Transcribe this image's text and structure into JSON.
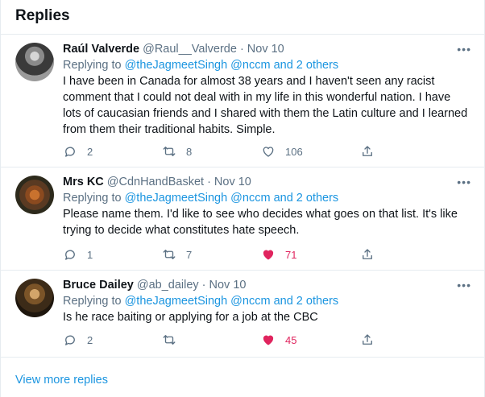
{
  "header": {
    "title": "Replies"
  },
  "replies": [
    {
      "name": "Raúl Valverde",
      "handle": "@Raul__Valverde",
      "separator": "·",
      "date": "Nov 10",
      "replying_prefix": "Replying to",
      "replying_to": "@theJagmeetSingh @nccm and 2 others",
      "text": "I have been in Canada for almost 38 years and I haven't seen any racist comment that I could not deal with in my life in this wonderful nation. I have lots of caucasian friends and I shared with them the Latin culture and I learned from them their traditional habits. Simple.",
      "replies": "2",
      "retweets": "8",
      "likes": "106",
      "liked": false
    },
    {
      "name": "Mrs KC",
      "handle": "@CdnHandBasket",
      "separator": "·",
      "date": "Nov 10",
      "replying_prefix": "Replying to",
      "replying_to": "@theJagmeetSingh @nccm and 2 others",
      "text": "Please name them. I'd like to see who decides what goes on that list. It's like trying to decide what constitutes hate speech.",
      "replies": "1",
      "retweets": "7",
      "likes": "71",
      "liked": true
    },
    {
      "name": "Bruce Dailey",
      "handle": "@ab_dailey",
      "separator": "·",
      "date": "Nov 10",
      "replying_prefix": "Replying to",
      "replying_to": "@theJagmeetSingh @nccm and 2 others",
      "text": "Is he race baiting or applying for a job at the CBC",
      "replies": "2",
      "retweets": "",
      "likes": "45",
      "liked": true
    }
  ],
  "more_icon": "more-dots-icon",
  "view_more": "View more replies",
  "colors": {
    "link": "#1b95e0",
    "muted": "#5b7083",
    "like": "#e0245e",
    "border": "#e6ecf0"
  }
}
